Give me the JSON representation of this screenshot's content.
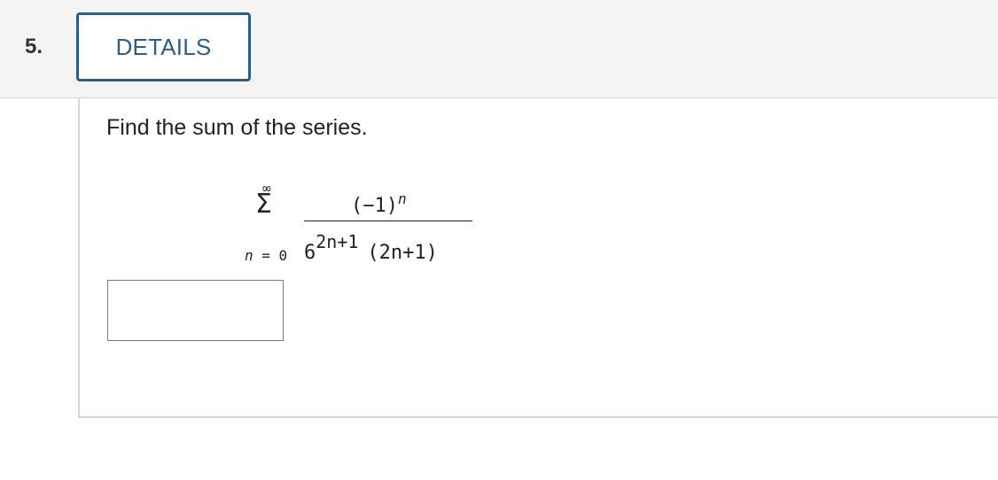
{
  "question": {
    "number": "5.",
    "details_label": "DETAILS",
    "prompt": "Find the sum of the series."
  },
  "series": {
    "upper_limit": "∞",
    "sigma": "Σ",
    "index_var": "n",
    "index_start": " = 0",
    "numerator_base": "(−1)",
    "numerator_exp": "n",
    "denominator_base": "6",
    "denominator_exp": "2n+1",
    "denominator_factor": "(2n+1)"
  },
  "answer": {
    "value": "",
    "placeholder": ""
  },
  "colors": {
    "accent": "#2f5d8a",
    "header_bg": "#f4f4f4",
    "border": "#d6d6d6",
    "input_border": "#7a7a7a"
  }
}
